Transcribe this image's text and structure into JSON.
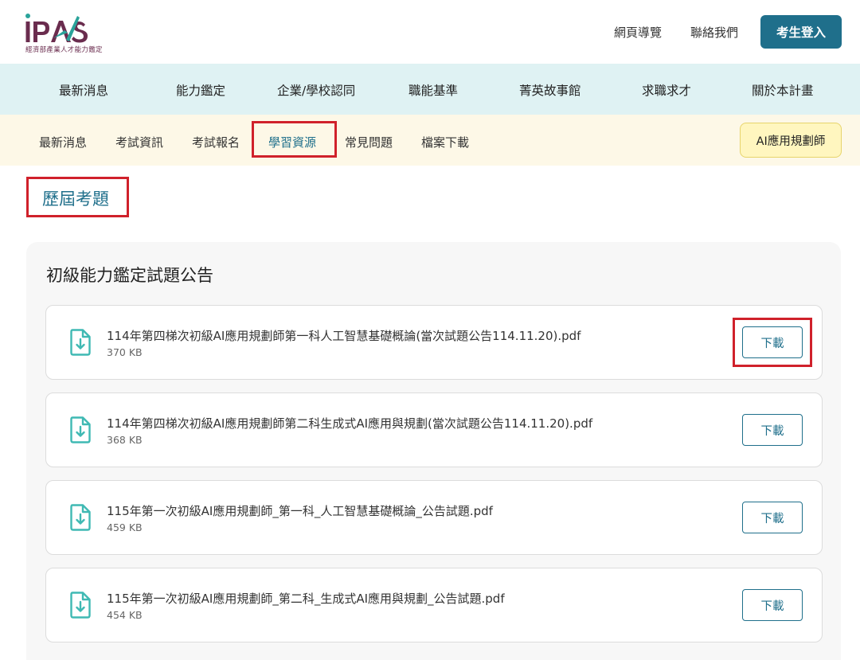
{
  "header": {
    "logo_text": "iPAS",
    "logo_subtitle": "經濟部產業人才能力鑑定",
    "links": [
      "網頁導覽",
      "聯絡我們"
    ],
    "login_label": "考生登入",
    "brand_color": "#1f6f8b"
  },
  "main_nav": [
    "最新消息",
    "能力鑑定",
    "企業/學校認同",
    "職能基準",
    "菁英故事館",
    "求職求才",
    "關於本計畫"
  ],
  "sub_nav": {
    "items": [
      "最新消息",
      "考試資訊",
      "考試報名",
      "學習資源",
      "常見問題",
      "檔案下載"
    ],
    "active": "學習資源",
    "ai_button": "AI應用規劃師"
  },
  "page_title": "歷屆考題",
  "section": {
    "title": "初級能力鑑定試題公告",
    "download_label": "下載",
    "files": [
      {
        "name": "114年第四梯次初級AI應用規劃師第一科人工智慧基礎概論(當次試題公告114.11.20).pdf",
        "size": "370 KB"
      },
      {
        "name": "114年第四梯次初級AI應用規劃師第二科生成式AI應用與規劃(當次試題公告114.11.20).pdf",
        "size": "368 KB"
      },
      {
        "name": "115年第一次初級AI應用規劃師_第一科_人工智慧基礎概論_公告試題.pdf",
        "size": "459 KB"
      },
      {
        "name": "115年第一次初級AI應用規劃師_第二科_生成式AI應用與規劃_公告試題.pdf",
        "size": "454 KB"
      }
    ]
  },
  "colors": {
    "highlight": "#d0212b",
    "main_nav_bg": "#dff2f3",
    "sub_nav_bg": "#fdf8e7",
    "icon_teal": "#3fb9b3"
  }
}
